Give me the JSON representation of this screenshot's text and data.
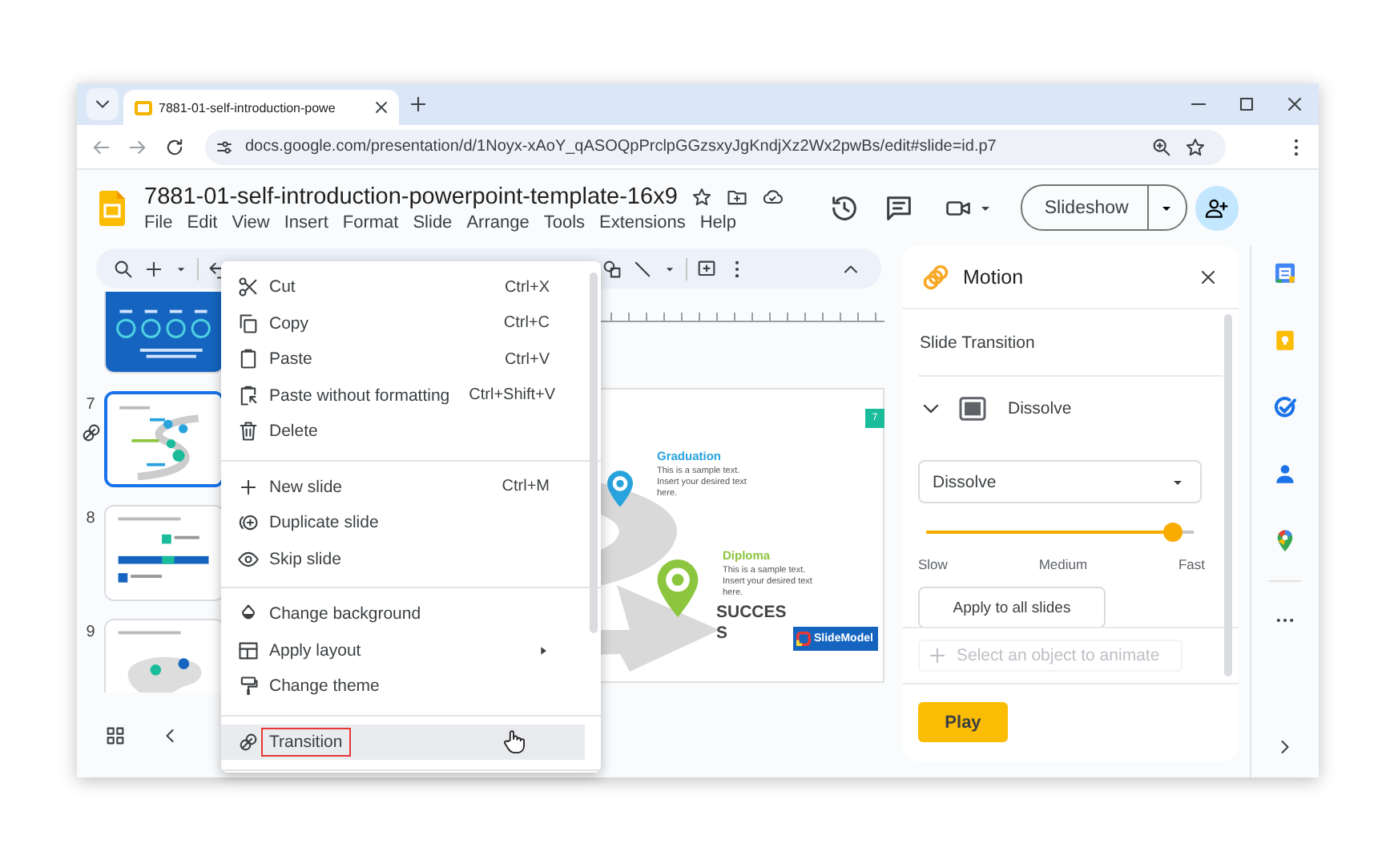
{
  "browser": {
    "tab": {
      "title": "7881-01-self-introduction-powe"
    },
    "url": "docs.google.com/presentation/d/1Noyx-xAoY_qASOQpPrclpGGzsxyJgKndjXz2Wx2pwBs/edit#slide=id.p7"
  },
  "document": {
    "title": "7881-01-self-introduction-powerpoint-template-16x9",
    "menus": [
      "File",
      "Edit",
      "View",
      "Insert",
      "Format",
      "Slide",
      "Arrange",
      "Tools",
      "Extensions",
      "Help"
    ],
    "slideshow_button": "Slideshow"
  },
  "filmstrip": [
    {
      "kind": "stats",
      "selected": false,
      "transition": false
    },
    {
      "number": "7",
      "kind": "education",
      "selected": true,
      "transition": true
    },
    {
      "number": "8",
      "kind": "timeline",
      "selected": false,
      "transition": false
    },
    {
      "number": "9",
      "kind": "map",
      "selected": false,
      "transition": false
    }
  ],
  "slide": {
    "badge": "7",
    "milestones": [
      {
        "title": "Graduation",
        "lines": [
          "This is a sample text.",
          "Insert your desired text",
          "here."
        ],
        "color": "#29a3dd"
      },
      {
        "title": "Diploma",
        "lines": [
          "This is a sample text.",
          "Insert your desired text",
          "here."
        ],
        "color": "#8cc63f"
      }
    ],
    "heading": "SUCCESS",
    "logo": "SlideModel"
  },
  "context_menu": {
    "groups": [
      [
        {
          "kind": "cut",
          "label": "Cut",
          "shortcut": "Ctrl+X",
          "submenu": false,
          "hovered": false,
          "outlined": false
        },
        {
          "kind": "copy",
          "label": "Copy",
          "shortcut": "Ctrl+C",
          "submenu": false,
          "hovered": false,
          "outlined": false
        },
        {
          "kind": "paste",
          "label": "Paste",
          "shortcut": "Ctrl+V",
          "submenu": false,
          "hovered": false,
          "outlined": false
        },
        {
          "kind": "pasteplain",
          "label": "Paste without formatting",
          "shortcut": "Ctrl+Shift+V",
          "submenu": false,
          "hovered": false,
          "outlined": false
        },
        {
          "kind": "trash",
          "label": "Delete",
          "submenu": false,
          "hovered": false,
          "outlined": false
        }
      ],
      [
        {
          "kind": "plus",
          "label": "New slide",
          "shortcut": "Ctrl+M",
          "submenu": false,
          "hovered": false,
          "outlined": false
        },
        {
          "kind": "duplicate",
          "label": "Duplicate slide",
          "submenu": false,
          "hovered": false,
          "outlined": false
        },
        {
          "kind": "eye",
          "label": "Skip slide",
          "submenu": false,
          "hovered": false,
          "outlined": false
        }
      ],
      [
        {
          "kind": "droplet",
          "label": "Change background",
          "submenu": false,
          "hovered": false,
          "outlined": false
        },
        {
          "kind": "layout",
          "label": "Apply layout",
          "submenu": true,
          "hovered": false,
          "outlined": false
        },
        {
          "kind": "roller",
          "label": "Change theme",
          "submenu": false,
          "hovered": false,
          "outlined": false
        }
      ],
      [
        {
          "kind": "transition",
          "label": "Transition",
          "submenu": false,
          "hovered": true,
          "outlined": true
        }
      ]
    ]
  },
  "motion_panel": {
    "title": "Motion",
    "section": "Slide Transition",
    "transition": "Dissolve",
    "expanded": true,
    "dropdown": "Dissolve",
    "speed": {
      "level": 0.92,
      "labels": [
        "Slow",
        "Medium",
        "Fast"
      ]
    },
    "apply_button": "Apply to all slides",
    "add_animation": {
      "placeholder": "Select an object to animate",
      "disabled": true
    },
    "play_button": "Play"
  }
}
